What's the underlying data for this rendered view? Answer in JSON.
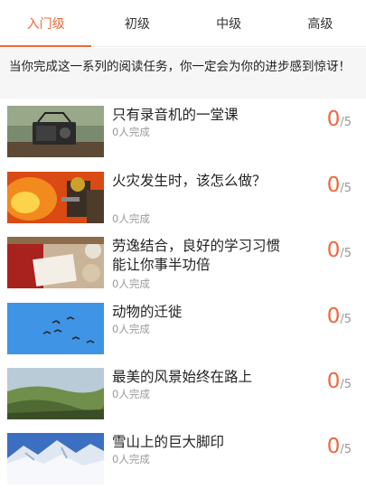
{
  "tabs": [
    {
      "label": "入门级",
      "active": true
    },
    {
      "label": "初级",
      "active": false
    },
    {
      "label": "中级",
      "active": false
    },
    {
      "label": "高级",
      "active": false
    }
  ],
  "banner": {
    "text": "当你完成这一系列的阅读任务，你一定会为你的进步感到惊讶！"
  },
  "lessons": [
    {
      "title": "只有录音机的一堂课",
      "completed": "0人完成",
      "score": "0",
      "total": "/5",
      "image": "radio"
    },
    {
      "title": "火灾发生时，该怎么做？",
      "completed": "0人完成",
      "score": "0",
      "total": "/5",
      "image": "firefighter"
    },
    {
      "title": "劳逸结合，良好的学习习惯能让你事半功倍",
      "completed": "0人完成",
      "score": "0",
      "total": "/5",
      "image": "study"
    },
    {
      "title": "动物的迁徙",
      "completed": "0人完成",
      "score": "0",
      "total": "/5",
      "image": "birds"
    },
    {
      "title": "最美的风景始终在路上",
      "completed": "0人完成",
      "score": "0",
      "total": "/5",
      "image": "landscape"
    },
    {
      "title": "雪山上的巨大脚印",
      "completed": "0人完成",
      "score": "0",
      "total": "/5",
      "image": "snow-mountain"
    }
  ],
  "colors": {
    "accent": "#f0673c",
    "muted": "#9a9a9a",
    "banner_bg": "#f6f6f6"
  }
}
